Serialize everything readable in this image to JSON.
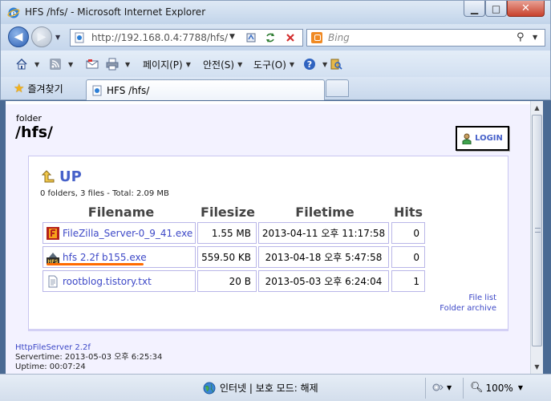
{
  "window": {
    "title": "HFS /hfs/ - Microsoft Internet Explorer",
    "minimize_glyph": "▁",
    "maximize_glyph": "□",
    "close_glyph": "✕"
  },
  "navigation": {
    "address": "http://192.168.0.4:7788/hfs/",
    "search_placeholder": "Bing"
  },
  "command_bar": {
    "page_label": "페이지(P)",
    "safety_label": "안전(S)",
    "tools_label": "도구(O)"
  },
  "tabs": {
    "favorites_label": "즐겨찾기",
    "active_tab_title": "HFS /hfs/"
  },
  "page": {
    "folder_label": "folder",
    "folder_path": "/hfs/",
    "login_label": "LOGIN",
    "up_label": "UP",
    "summary": "0 folders, 3 files - Total: 2.09 MB",
    "columns": [
      "Filename",
      "Filesize",
      "Filetime",
      "Hits"
    ],
    "files": [
      {
        "name": "FileZilla_Server-0_9_41.exe",
        "size": "1.55 MB",
        "time": "2013-04-11 오후 11:17:58",
        "hits": "0",
        "icon": "filezilla-icon"
      },
      {
        "name": "hfs 2.2f b155.exe",
        "size": "559.50 KB",
        "time": "2013-04-18 오후 5:47:58",
        "hits": "0",
        "icon": "hfs-app-icon"
      },
      {
        "name": "rootblog.tistory.txt",
        "size": "20 B",
        "time": "2013-05-03 오후 6:24:04",
        "hits": "1",
        "icon": "text-file-icon"
      }
    ],
    "file_list_link": "File list",
    "folder_archive_link": "Folder archive",
    "footer": {
      "server_link": "HttpFileServer 2.2f",
      "servertime": "Servertime: 2013-05-03 오후 6:25:34",
      "uptime": "Uptime: 00:07:24"
    }
  },
  "status_bar": {
    "zone_text": "인터넷 | 보호 모드: 해제",
    "zoom": "100%"
  },
  "colors": {
    "link": "#3d48c7",
    "accent_blue": "#4661c9",
    "page_bg": "#f3f2ff",
    "highlight": "#ff6a00"
  }
}
